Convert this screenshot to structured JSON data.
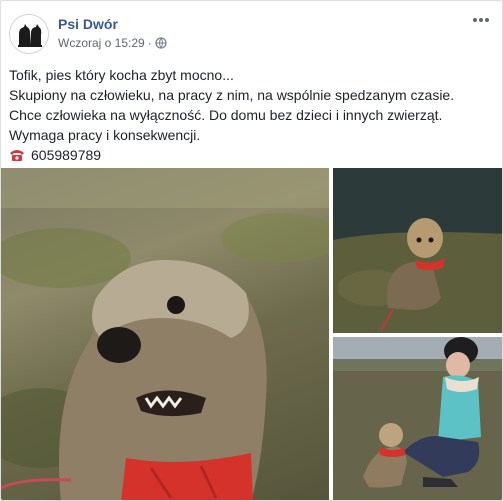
{
  "post": {
    "author": "Psi Dwór",
    "timestamp": "Wczoraj o 15:29",
    "timestamp_separator": "·",
    "audience_icon": "globe-icon",
    "more_icon": "more-options-icon",
    "text_lines": [
      "Tofik, pies który kocha zbyt mocno...",
      "Skupiony na człowieku, na pracy z nim, na wspólnie spedzanym czasie.",
      "Chce człowieka na wyłączność. Do domu bez dzieci i innych zwierząt.",
      "Wymaga pracy i konsekwencji."
    ],
    "phone_icon": "telephone-icon",
    "phone": "605989789"
  },
  "photos": [
    {
      "name": "photo-dog-closeup",
      "icon": "photo-icon"
    },
    {
      "name": "photo-dog-by-water",
      "icon": "photo-icon"
    },
    {
      "name": "photo-dog-with-woman",
      "icon": "photo-icon"
    }
  ],
  "colors": {
    "author": "#385898",
    "text": "#1d2129",
    "meta": "#616770",
    "phone_icon": "#d8363f",
    "harness": "#d6322c"
  }
}
